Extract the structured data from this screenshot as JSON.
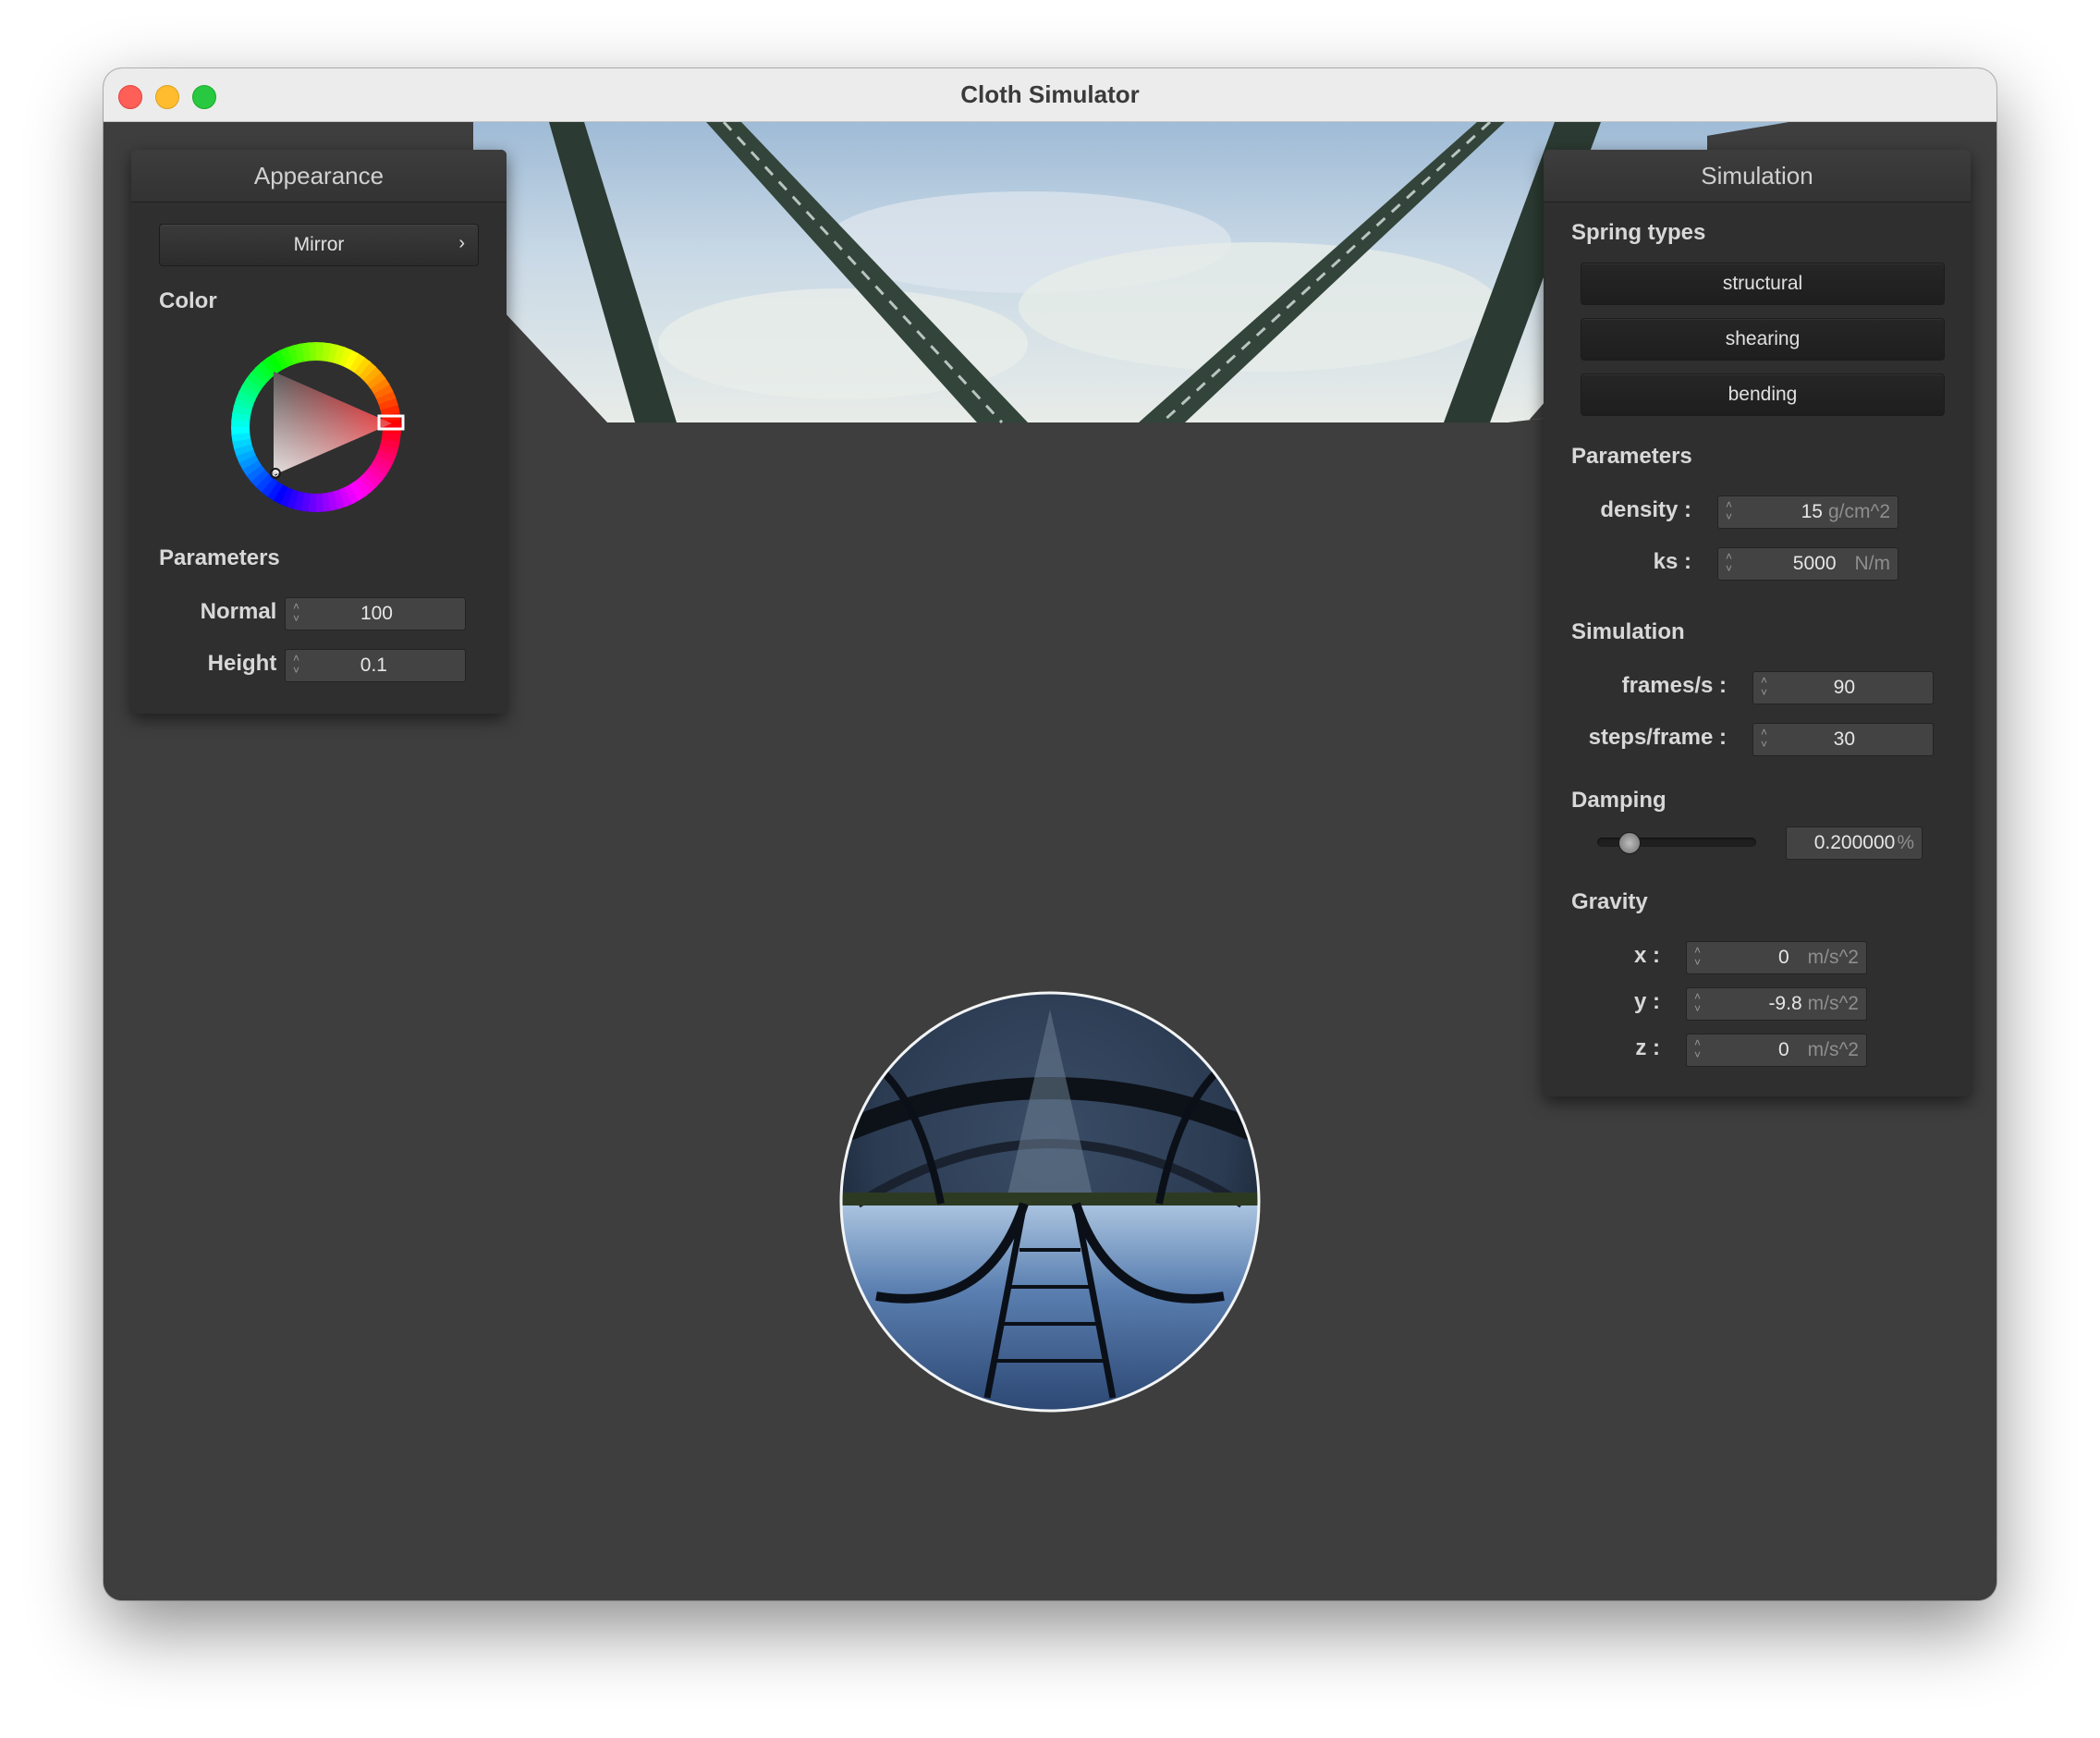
{
  "window": {
    "title": "Cloth Simulator"
  },
  "appearance": {
    "title": "Appearance",
    "shader_button": "Mirror",
    "chevron": "›",
    "color_label": "Color",
    "params_label": "Parameters",
    "normal_label": "Normal :",
    "normal_value": "100",
    "height_label": "Height :",
    "height_value": "0.1",
    "selected_hue_color": "#e8262a"
  },
  "simulation": {
    "title": "Simulation",
    "spring_types_label": "Spring types",
    "springs": [
      "structural",
      "shearing",
      "bending"
    ],
    "params_label": "Parameters",
    "density_label": "density :",
    "density_value": "15",
    "density_unit": "g/cm^2",
    "ks_label": "ks :",
    "ks_value": "5000",
    "ks_unit": "N/m",
    "sim_label": "Simulation",
    "fps_label": "frames/s :",
    "fps_value": "90",
    "steps_label": "steps/frame :",
    "steps_value": "30",
    "damping_label": "Damping",
    "damping_value": "0.200000",
    "damping_unit": "%",
    "damping_fraction": 0.2,
    "gravity_label": "Gravity",
    "gx_label": "x :",
    "gx_value": "0",
    "gy_label": "y :",
    "gy_value": "-9.8",
    "gz_label": "z :",
    "gz_value": "0",
    "gravity_unit": "m/s^2"
  },
  "icons": {
    "spinner": "up-down-spinner-icon",
    "chevron": "chevron-right-icon",
    "traffic": [
      "close-icon",
      "minimize-icon",
      "zoom-icon"
    ]
  }
}
